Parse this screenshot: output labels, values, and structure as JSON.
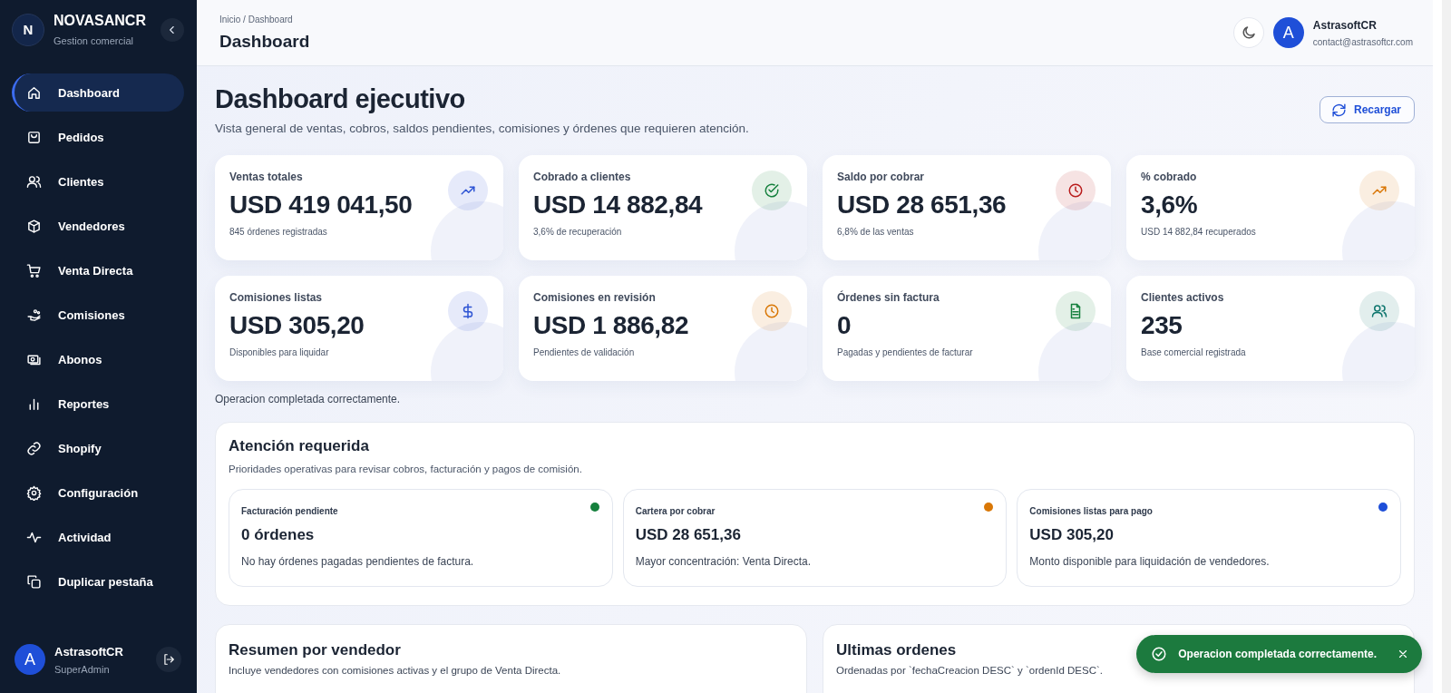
{
  "sidebar": {
    "brand": {
      "initial": "N",
      "name": "NOVASANCR",
      "subtitle": "Gestion comercial"
    },
    "items": [
      {
        "label": "Dashboard",
        "kind": "home",
        "selected": true
      },
      {
        "label": "Pedidos",
        "kind": "bag",
        "selected": false
      },
      {
        "label": "Clientes",
        "kind": "users",
        "selected": false
      },
      {
        "label": "Vendedores",
        "kind": "box",
        "selected": false
      },
      {
        "label": "Venta Directa",
        "kind": "cart",
        "selected": false
      },
      {
        "label": "Comisiones",
        "kind": "hand",
        "selected": false
      },
      {
        "label": "Abonos",
        "kind": "cash",
        "selected": false
      },
      {
        "label": "Reportes",
        "kind": "bars",
        "selected": false
      },
      {
        "label": "Shopify",
        "kind": "link",
        "selected": false
      },
      {
        "label": "Configuración",
        "kind": "gear",
        "selected": false
      },
      {
        "label": "Actividad",
        "kind": "pulse",
        "selected": false
      },
      {
        "label": "Duplicar pestaña",
        "kind": "copy",
        "selected": false
      }
    ],
    "user": {
      "initial": "A",
      "name": "AstrasoftCR",
      "role": "SuperAdmin"
    }
  },
  "header": {
    "breadcrumb": "Inicio / Dashboard",
    "title": "Dashboard",
    "user": {
      "initial": "A",
      "name": "AstrasoftCR",
      "email": "contact@astrasoftcr.com"
    }
  },
  "page": {
    "title": "Dashboard ejecutivo",
    "subtitle": "Vista general de ventas, cobros, saldos pendientes, comisiones y órdenes que requieren atención.",
    "reload_button": "Recargar"
  },
  "kpis": [
    {
      "label": "Ventas totales",
      "value": "USD 419 041,50",
      "note": "845 órdenes registradas",
      "kind": "trend",
      "color": "#2f55d4"
    },
    {
      "label": "Cobrado a clientes",
      "value": "USD 14 882,84",
      "note": "3,6% de recuperación",
      "kind": "check",
      "color": "#15803d"
    },
    {
      "label": "Saldo por cobrar",
      "value": "USD 28 651,36",
      "note": "6,8% de las ventas",
      "kind": "clock",
      "color": "#b91c1c"
    },
    {
      "label": "% cobrado",
      "value": "3,6%",
      "note": "USD 14 882,84 recuperados",
      "kind": "trend",
      "color": "#d97706"
    },
    {
      "label": "Comisiones listas",
      "value": "USD 305,20",
      "note": "Disponibles para liquidar",
      "kind": "dollar",
      "color": "#2f55d4"
    },
    {
      "label": "Comisiones en revisión",
      "value": "USD 1 886,82",
      "note": "Pendientes de validación",
      "kind": "clock",
      "color": "#d97706"
    },
    {
      "label": "Órdenes sin factura",
      "value": "0",
      "note": "Pagadas y pendientes de facturar",
      "kind": "file",
      "color": "#15803d"
    },
    {
      "label": "Clientes activos",
      "value": "235",
      "note": "Base comercial registrada",
      "kind": "users",
      "color": "#0f766e"
    }
  ],
  "status_message": "Operacion completada correctamente.",
  "attention": {
    "title": "Atención requerida",
    "subtitle": "Prioridades operativas para revisar cobros, facturación y pagos de comisión.",
    "items": [
      {
        "label": "Facturación pendiente",
        "value": "0 órdenes",
        "note": "No hay órdenes pagadas pendientes de factura.",
        "color": "#15803d"
      },
      {
        "label": "Cartera por cobrar",
        "value": "USD 28 651,36",
        "note": "Mayor concentración: Venta Directa.",
        "color": "#d97706"
      },
      {
        "label": "Comisiones listas para pago",
        "value": "USD 305,20",
        "note": "Monto disponible para liquidación de vendedores.",
        "color": "#1d4ed8"
      }
    ]
  },
  "panels": [
    {
      "title": "Resumen por vendedor",
      "subtitle": "Incluye vendedores con comisiones activas y el grupo de Venta Directa."
    },
    {
      "title": "Ultimas ordenes",
      "subtitle": "Ordenadas por `fechaCreacion DESC` y `ordenId DESC`."
    }
  ],
  "toast": {
    "message": "Operacion completada correctamente."
  }
}
